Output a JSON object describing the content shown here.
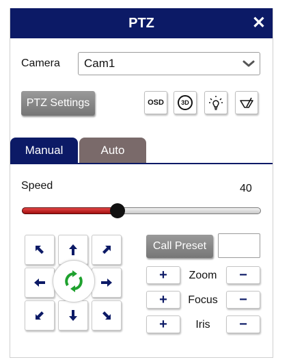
{
  "header": {
    "title": "PTZ",
    "close_icon": "close-icon",
    "close_glyph": "✕"
  },
  "camera": {
    "label": "Camera",
    "selected": "Cam1"
  },
  "toolbar": {
    "ptz_settings_label": "PTZ Settings",
    "osd_label": "OSD",
    "3d_label": "3D",
    "light_icon": "lightbulb-icon",
    "wiper_icon": "wiper-icon"
  },
  "tabs": [
    {
      "label": "Manual",
      "active": true
    },
    {
      "label": "Auto",
      "active": false
    }
  ],
  "speed": {
    "label": "Speed",
    "value": "40",
    "fraction": 0.4
  },
  "preset": {
    "call_label": "Call Preset",
    "input_value": ""
  },
  "controls": {
    "zoom_label": "Zoom",
    "focus_label": "Focus",
    "iris_label": "Iris",
    "plus": "+",
    "minus": "−"
  },
  "colors": {
    "title_bar": "#0c1a66",
    "active_tab": "#0c1a66",
    "inactive_tab": "#7a6a6a",
    "slider_fill": "#c21a1a",
    "pad_arrow": "#0c1a66",
    "refresh": "#1ea12e"
  }
}
